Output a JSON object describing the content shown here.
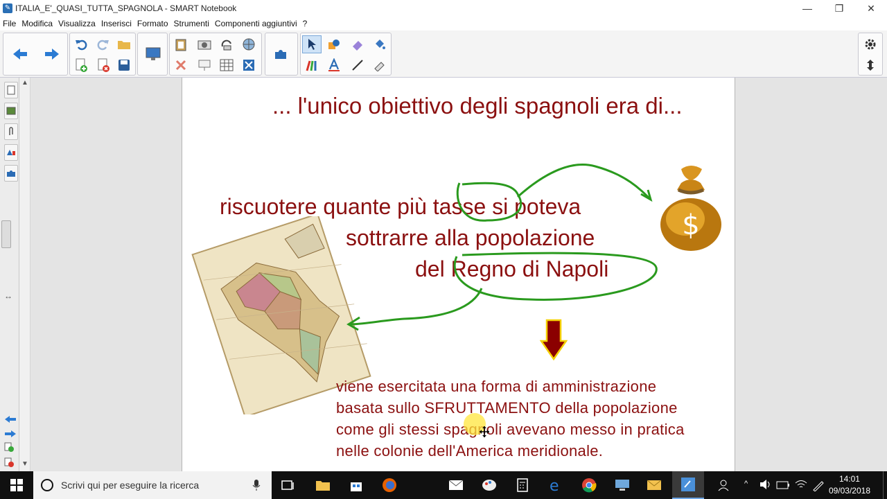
{
  "window": {
    "title": "ITALIA_E'_QUASI_TUTTA_SPAGNOLA - SMART Notebook",
    "controls": [
      "minimize",
      "restore",
      "close"
    ]
  },
  "menubar": {
    "items": [
      "File",
      "Modifica",
      "Visualizza",
      "Inserisci",
      "Formato",
      "Strumenti",
      "Componenti aggiuntivi",
      "?"
    ]
  },
  "slide": {
    "title": "... l'unico obiettivo degli spagnoli era di...",
    "line1_pre": "riscuotere quante più ",
    "line1_circled": "tasse",
    "line1_post": " si poteva",
    "line2": "sottrarre alla popolazione",
    "line3_pre": "del ",
    "line3_circled": "Regno di Napoli",
    "body": [
      "viene esercitata una forma di amministrazione",
      "basata sullo SFRUTTAMENTO della popolazione",
      "come gli stessi spagnoli avevano messo in pratica",
      "nelle colonie dell'America meridionale."
    ],
    "money_symbol": "$"
  },
  "taskbar": {
    "search_placeholder": "Scrivi qui per eseguire la ricerca",
    "time": "14:01",
    "date": "09/03/2018"
  },
  "colors": {
    "slide_text": "#8b1010",
    "annotation_green": "#2a9a1e",
    "arrow_red": "#8b0000",
    "arrow_outline": "#f4d000"
  }
}
